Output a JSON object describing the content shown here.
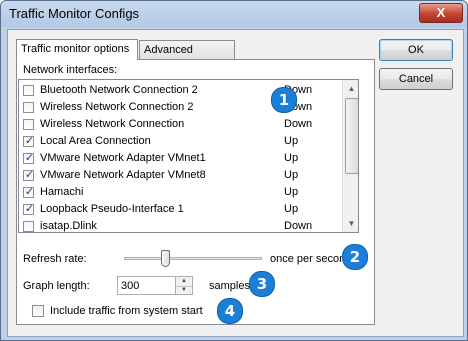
{
  "window": {
    "title": "Traffic Monitor Configs",
    "close_symbol": "X"
  },
  "tabs": [
    {
      "label": "Traffic monitor options",
      "active": true
    },
    {
      "label": "Advanced options",
      "active": false
    }
  ],
  "network": {
    "label": "Network interfaces:",
    "items": [
      {
        "name": "Bluetooth Network Connection 2",
        "status": "Down",
        "checked": false
      },
      {
        "name": "Wireless Network Connection 2",
        "status": "Down",
        "checked": false
      },
      {
        "name": "Wireless Network Connection",
        "status": "Down",
        "checked": false
      },
      {
        "name": "Local Area Connection",
        "status": "Up",
        "checked": true
      },
      {
        "name": "VMware Network Adapter VMnet1",
        "status": "Up",
        "checked": true
      },
      {
        "name": "VMware Network Adapter VMnet8",
        "status": "Up",
        "checked": true
      },
      {
        "name": "Hamachi",
        "status": "Up",
        "checked": true
      },
      {
        "name": "Loopback Pseudo-Interface 1",
        "status": "Up",
        "checked": true
      },
      {
        "name": "isatap.Dlink",
        "status": "Down",
        "checked": false
      }
    ]
  },
  "refresh": {
    "label": "Refresh rate:",
    "suffix": "once per second"
  },
  "graph": {
    "label": "Graph length:",
    "value": "300",
    "unit": "samples"
  },
  "include_traffic": {
    "label": "Include traffic from system start",
    "checked": false
  },
  "buttons": {
    "ok": "OK",
    "cancel": "Cancel"
  },
  "badges": [
    "1",
    "2",
    "3",
    "4"
  ],
  "colors": {
    "badge_blue": "#1b7fd7",
    "title_bar": "#bcd0e8",
    "close_red": "#c44532"
  }
}
